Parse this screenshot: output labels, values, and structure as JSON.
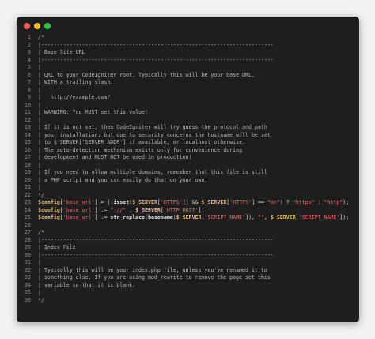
{
  "window": {
    "traffic_lights": [
      {
        "name": "close",
        "color": "#ff5f57"
      },
      {
        "name": "minimize",
        "color": "#febc2e"
      },
      {
        "name": "zoom",
        "color": "#28c840"
      }
    ]
  },
  "code": {
    "lines": [
      {
        "n": "1",
        "tokens": [
          {
            "t": "/*",
            "k": "c"
          }
        ]
      },
      {
        "n": "2",
        "tokens": [
          {
            "t": "|--------------------------------------------------------------------------",
            "k": "c"
          }
        ]
      },
      {
        "n": "3",
        "tokens": [
          {
            "t": "| Base Site URL",
            "k": "c"
          }
        ]
      },
      {
        "n": "4",
        "tokens": [
          {
            "t": "|--------------------------------------------------------------------------",
            "k": "c"
          }
        ]
      },
      {
        "n": "5",
        "tokens": [
          {
            "t": "|",
            "k": "c"
          }
        ]
      },
      {
        "n": "6",
        "tokens": [
          {
            "t": "| URL to your CodeIgniter root. Typically this will be your base URL,",
            "k": "c"
          }
        ]
      },
      {
        "n": "7",
        "tokens": [
          {
            "t": "| WITH a trailing slash:",
            "k": "c"
          }
        ]
      },
      {
        "n": "8",
        "tokens": [
          {
            "t": "|",
            "k": "c"
          }
        ]
      },
      {
        "n": "9",
        "tokens": [
          {
            "t": "|   http://example.com/",
            "k": "c"
          }
        ]
      },
      {
        "n": "10",
        "tokens": [
          {
            "t": "|",
            "k": "c"
          }
        ]
      },
      {
        "n": "11",
        "tokens": [
          {
            "t": "| WARNING: You MUST set this value!",
            "k": "c"
          }
        ]
      },
      {
        "n": "12",
        "tokens": [
          {
            "t": "|",
            "k": "c"
          }
        ]
      },
      {
        "n": "13",
        "tokens": [
          {
            "t": "| If it is not set, then CodeIgniter will try guess the protocol and path",
            "k": "c"
          }
        ]
      },
      {
        "n": "14",
        "tokens": [
          {
            "t": "| your installation, but due to security concerns the hostname will be set",
            "k": "c"
          }
        ]
      },
      {
        "n": "15",
        "tokens": [
          {
            "t": "| to $_SERVER['SERVER_ADDR'] if available, or localhost otherwise.",
            "k": "c"
          }
        ]
      },
      {
        "n": "16",
        "tokens": [
          {
            "t": "| The auto-detection mechanism exists only for convenience during",
            "k": "c"
          }
        ]
      },
      {
        "n": "17",
        "tokens": [
          {
            "t": "| development and MUST NOT be used in production!",
            "k": "c"
          }
        ]
      },
      {
        "n": "18",
        "tokens": [
          {
            "t": "|",
            "k": "c"
          }
        ]
      },
      {
        "n": "19",
        "tokens": [
          {
            "t": "| If you need to allow multiple domains, remember that this file is still",
            "k": "c"
          }
        ]
      },
      {
        "n": "20",
        "tokens": [
          {
            "t": "| a PHP script and you can easily do that on your own.",
            "k": "c"
          }
        ]
      },
      {
        "n": "21",
        "tokens": [
          {
            "t": "|",
            "k": "c"
          }
        ]
      },
      {
        "n": "22",
        "tokens": [
          {
            "t": "*/",
            "k": "c"
          }
        ]
      },
      {
        "n": "23",
        "tokens": [
          {
            "t": "$config",
            "k": "v"
          },
          {
            "t": "[",
            "k": "p"
          },
          {
            "t": "'base_url'",
            "k": "s"
          },
          {
            "t": "] = ((",
            "k": "p"
          },
          {
            "t": "isset",
            "k": "f"
          },
          {
            "t": "(",
            "k": "p"
          },
          {
            "t": "$_SERVER",
            "k": "v"
          },
          {
            "t": "[",
            "k": "p"
          },
          {
            "t": "'HTTPS'",
            "k": "s"
          },
          {
            "t": "]) && ",
            "k": "p"
          },
          {
            "t": "$_SERVER",
            "k": "v"
          },
          {
            "t": "[",
            "k": "p"
          },
          {
            "t": "'HTTPS'",
            "k": "s"
          },
          {
            "t": "] == ",
            "k": "p"
          },
          {
            "t": "\"on\"",
            "k": "s"
          },
          {
            "t": ") ? ",
            "k": "p"
          },
          {
            "t": "\"https\"",
            "k": "s"
          },
          {
            "t": " : ",
            "k": "p"
          },
          {
            "t": "\"http\"",
            "k": "s"
          },
          {
            "t": ");",
            "k": "p"
          }
        ]
      },
      {
        "n": "24",
        "tokens": [
          {
            "t": "$config",
            "k": "v"
          },
          {
            "t": "[",
            "k": "p"
          },
          {
            "t": "'base_url'",
            "k": "s"
          },
          {
            "t": "] .= ",
            "k": "p"
          },
          {
            "t": "\"://\"",
            "k": "s"
          },
          {
            "t": " . ",
            "k": "p"
          },
          {
            "t": "$_SERVER",
            "k": "v"
          },
          {
            "t": "[",
            "k": "p"
          },
          {
            "t": "'HTTP_HOST'",
            "k": "s"
          },
          {
            "t": "];",
            "k": "p"
          }
        ]
      },
      {
        "n": "25",
        "tokens": [
          {
            "t": "$config",
            "k": "v"
          },
          {
            "t": "[",
            "k": "p"
          },
          {
            "t": "'base_url'",
            "k": "s"
          },
          {
            "t": "] .= ",
            "k": "p"
          },
          {
            "t": "str_replace",
            "k": "f"
          },
          {
            "t": "(",
            "k": "p"
          },
          {
            "t": "basename",
            "k": "f"
          },
          {
            "t": "(",
            "k": "p"
          },
          {
            "t": "$_SERVER",
            "k": "v"
          },
          {
            "t": "[",
            "k": "p"
          },
          {
            "t": "'SCRIPT_NAME'",
            "k": "s"
          },
          {
            "t": "]), ",
            "k": "p"
          },
          {
            "t": "\"\"",
            "k": "s"
          },
          {
            "t": ", ",
            "k": "p"
          },
          {
            "t": "$_SERVER",
            "k": "v"
          },
          {
            "t": "[",
            "k": "p"
          },
          {
            "t": "'SCRIPT_NAME'",
            "k": "s"
          },
          {
            "t": "]);",
            "k": "p"
          }
        ]
      },
      {
        "n": "26",
        "tokens": []
      },
      {
        "n": "27",
        "tokens": [
          {
            "t": "/*",
            "k": "c"
          }
        ]
      },
      {
        "n": "28",
        "tokens": [
          {
            "t": "|--------------------------------------------------------------------------",
            "k": "c"
          }
        ]
      },
      {
        "n": "29",
        "tokens": [
          {
            "t": "| Index File",
            "k": "c"
          }
        ]
      },
      {
        "n": "30",
        "tokens": [
          {
            "t": "|--------------------------------------------------------------------------",
            "k": "c"
          }
        ]
      },
      {
        "n": "31",
        "tokens": [
          {
            "t": "|",
            "k": "c"
          }
        ]
      },
      {
        "n": "32",
        "tokens": [
          {
            "t": "| Typically this will be your index.php file, unless you've renamed it to",
            "k": "c"
          }
        ]
      },
      {
        "n": "33",
        "tokens": [
          {
            "t": "| something else. If you are using mod_rewrite to remove the page set this",
            "k": "c"
          }
        ]
      },
      {
        "n": "34",
        "tokens": [
          {
            "t": "| variable so that it is blank.",
            "k": "c"
          }
        ]
      },
      {
        "n": "35",
        "tokens": [
          {
            "t": "|",
            "k": "c"
          }
        ]
      },
      {
        "n": "36",
        "tokens": [
          {
            "t": "*/",
            "k": "c"
          }
        ]
      }
    ]
  }
}
